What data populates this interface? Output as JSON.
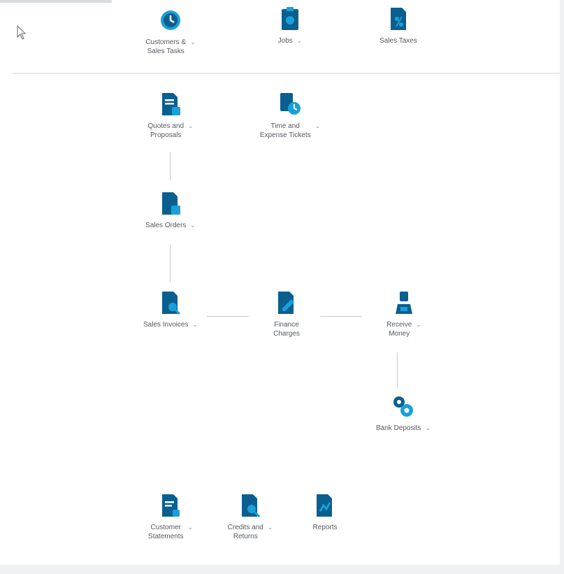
{
  "colors": {
    "icon_dark": "#0b5f8f",
    "icon_accent": "#1aa0d8",
    "text": "#55595e",
    "divider": "#e6e8ea",
    "connector": "#c7ccd1"
  },
  "top_row": [
    {
      "id": "customers",
      "label": "Customers &\nSales Tasks",
      "icon": "clock-user-icon"
    },
    {
      "id": "jobs",
      "label": "Jobs",
      "icon": "clipboard-icon"
    },
    {
      "id": "sales-taxes",
      "label": "Sales Taxes",
      "icon": "document-percent-icon"
    }
  ],
  "flow": {
    "quotes": {
      "label": "Quotes and\nProposals",
      "icon": "document-list-icon"
    },
    "time_expense": {
      "label": "Time and\nExpense Tickets",
      "icon": "time-expense-icon"
    },
    "sales_orders": {
      "label": "Sales Orders",
      "icon": "document-cart-icon"
    },
    "sales_invoices": {
      "label": "Sales Invoices",
      "icon": "document-search-icon"
    },
    "finance_charges": {
      "label": "Finance\nCharges",
      "icon": "document-edit-icon"
    },
    "receive_money": {
      "label": "Receive\nMoney",
      "icon": "money-person-icon"
    },
    "bank_deposits": {
      "label": "Bank Deposits",
      "icon": "bank-gears-icon"
    }
  },
  "bottom_row": [
    {
      "id": "customer-statements",
      "label": "Customer\nStatements",
      "icon": "statement-icon"
    },
    {
      "id": "credits-returns",
      "label": "Credits and\nReturns",
      "icon": "credits-search-icon"
    },
    {
      "id": "reports",
      "label": "Reports",
      "icon": "report-icon"
    }
  ],
  "chevron": "⌄"
}
